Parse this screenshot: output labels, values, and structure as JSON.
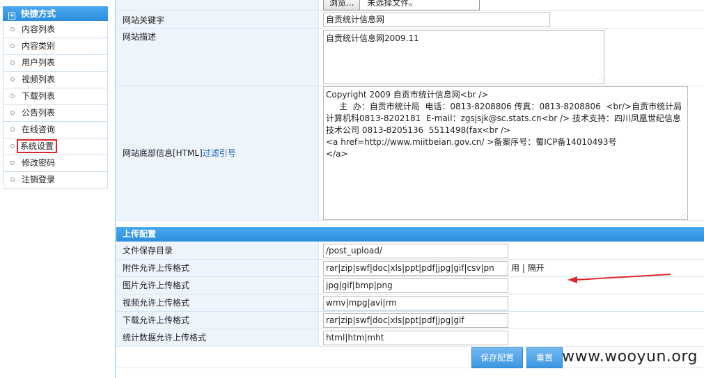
{
  "sidebar": {
    "title": "快捷方式",
    "items": [
      {
        "label": "内容列表"
      },
      {
        "label": "内容类别"
      },
      {
        "label": "用户列表"
      },
      {
        "label": "视频列表"
      },
      {
        "label": "下载列表"
      },
      {
        "label": "公告列表"
      },
      {
        "label": "在线咨询"
      },
      {
        "label": "系统设置"
      },
      {
        "label": "修改密码"
      },
      {
        "label": "注销登录"
      }
    ]
  },
  "site_settings": {
    "browse_button": "浏览...",
    "no_file": "未选择文件。",
    "keywords": {
      "label": "网站关键字",
      "value": "自贡统计信息网"
    },
    "description": {
      "label": "网站描述",
      "value": "自贡统计信息网2009.11"
    },
    "footer": {
      "label": "网站底部信息[HTML]",
      "filter_link": "过滤引号",
      "value": "Copyright 2009 自贡市统计信息网<br />\n     主  办：自贡市统计局  电话：0813-8208806 传真：0813-8208806  <br/>自贡市统计局 计算机科0813-8202181  E-mail：zgsjsjk@sc.stats.cn<br /> 技术支持：四川凤凰世纪信息技术公司 0813-8205136  5511498(fax<br />\n<a href=http://www.miitbeian.gov.cn/ >备案序号：蜀ICP备14010493号\n</a>"
    }
  },
  "upload_config": {
    "title": "上传配置",
    "save_dir": {
      "label": "文件保存目录",
      "value": "/post_upload/"
    },
    "attachment_formats": {
      "label": "附件允许上传格式",
      "value": "rar|zip|swf|doc|xls|ppt|pdf|jpg|gif|csv|pn",
      "hint": "用 |  隔开"
    },
    "image_formats": {
      "label": "图片允许上传格式",
      "value": "jpg|gif|bmp|png"
    },
    "video_formats": {
      "label": "视频允许上传格式",
      "value": "wmv|mpg|avi|rm"
    },
    "download_formats": {
      "label": "下载允许上传格式",
      "value": "rar|zip|swf|doc|xls|ppt|pdf|jpg|gif"
    },
    "stats_formats": {
      "label": "统计数据允许上传格式",
      "value": "html|htm|mht"
    }
  },
  "buttons": {
    "save": "保存配置",
    "reset": "重置"
  },
  "watermark": "www.wooyun.org",
  "colors": {
    "accent": "#2b8fde",
    "highlight_box": "#e0262d",
    "arrow": "#e0262d"
  }
}
